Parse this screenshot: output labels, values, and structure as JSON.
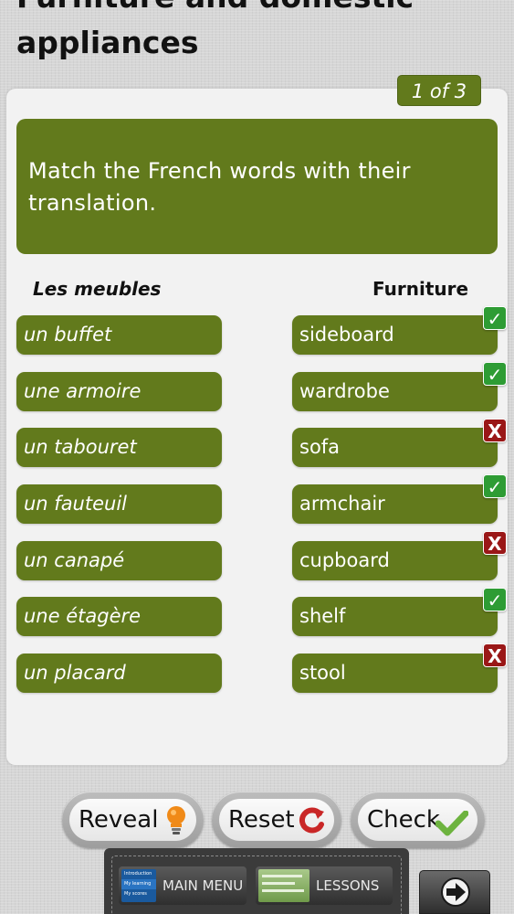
{
  "page": {
    "title": "Furniture and domestic appliances"
  },
  "pager": {
    "label": "1 of 3"
  },
  "instruction": "Match the French words with their translation.",
  "columns": {
    "left": "Les meubles",
    "right": "Furniture"
  },
  "pairs": [
    {
      "french": "un buffet",
      "english": "sideboard",
      "correct": true
    },
    {
      "french": "une armoire",
      "english": "wardrobe",
      "correct": true
    },
    {
      "french": "un tabouret",
      "english": "sofa",
      "correct": false
    },
    {
      "french": "un fauteuil",
      "english": "armchair",
      "correct": true
    },
    {
      "french": "un canapé",
      "english": "cupboard",
      "correct": false
    },
    {
      "french": "une étagère",
      "english": "shelf",
      "correct": true
    },
    {
      "french": "un placard",
      "english": "stool",
      "correct": false
    }
  ],
  "marks": {
    "ok_icon": "check-icon",
    "bad_icon": "x-icon",
    "ok_color": "#2e9c34",
    "bad_color": "#9a1717"
  },
  "buttons": {
    "reveal": "Reveal",
    "reset": "Reset",
    "check": "Check"
  },
  "bottom_nav": {
    "main_menu": "MAIN MENU",
    "lessons": "LESSONS",
    "thumb_lines": [
      "Introduction",
      "My learning",
      "My scores"
    ]
  },
  "colors": {
    "accent": "#627a1c"
  }
}
